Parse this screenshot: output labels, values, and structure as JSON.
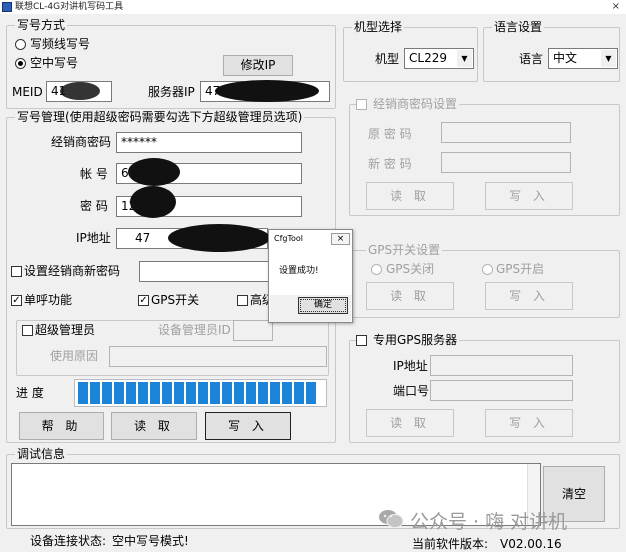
{
  "window": {
    "title": "联想CL-4G对讲机写码工具",
    "close_glyph": "×"
  },
  "write_mode": {
    "legend": "写号方式",
    "options": [
      {
        "label": "写频线写号",
        "checked": false
      },
      {
        "label": "空中写号",
        "checked": true
      }
    ],
    "modify_ip_button": "修改IP",
    "meid_label": "MEID",
    "meid_value": "41",
    "server_ip_label": "服务器IP",
    "server_ip_value": "47"
  },
  "model_select": {
    "legend": "机型选择",
    "label": "机型",
    "value": "CL229"
  },
  "language": {
    "legend": "语言设置",
    "label": "语言",
    "value": "中文"
  },
  "account": {
    "legend": "写号管理(使用超级密码需要勾选下方超级管理员选项)",
    "dealer_pwd_label": "经销商密码",
    "dealer_pwd_value": "******",
    "account_label": "帐 号",
    "account_value": "60",
    "password_label": "密 码",
    "password_value": "12",
    "ip_label": "IP地址",
    "ip_value": "47",
    "set_new_pwd_label": "设置经销商新密码",
    "single_call_label": "单呼功能",
    "gps_switch_label": "GPS开关",
    "high_label": "高级",
    "super_admin_label": "超级管理员",
    "device_admin_id_label": "设备管理员ID",
    "reason_label": "使用原因",
    "progress_label": "进 度",
    "progress_filled": 1.0,
    "help_button": "帮 助",
    "read_button": "读 取",
    "write_button": "写 入"
  },
  "dealer_pwd": {
    "legend": "经销商密码设置",
    "old_label": "原 密 码",
    "new_label": "新 密 码",
    "read_button": "读 取",
    "write_button": "写 入"
  },
  "gps_switch": {
    "legend": "GPS开关设置",
    "off_label": "GPS关闭",
    "on_label": "GPS开启",
    "read_button": "读 取",
    "write_button": "写 入"
  },
  "gps_server": {
    "legend": "专用GPS服务器",
    "ip_label": "IP地址",
    "port_label": "端口号",
    "read_button": "读 取",
    "write_button": "写 入"
  },
  "debug": {
    "legend": "调试信息",
    "clear_button": "清空"
  },
  "status": {
    "connection_label": "设备连接状态:",
    "connection_value": "空中写号模式!",
    "version_label": "当前软件版本:",
    "version_value": "V02.00.16"
  },
  "dialog": {
    "title": "CfgTool",
    "close_glyph": "×",
    "message": "设置成功!",
    "ok_button": "确定"
  },
  "watermark": "公众号 · 嗨 对讲机",
  "colors": {
    "progress": "#1c84d8",
    "disabled_text": "#a0a0a0"
  }
}
